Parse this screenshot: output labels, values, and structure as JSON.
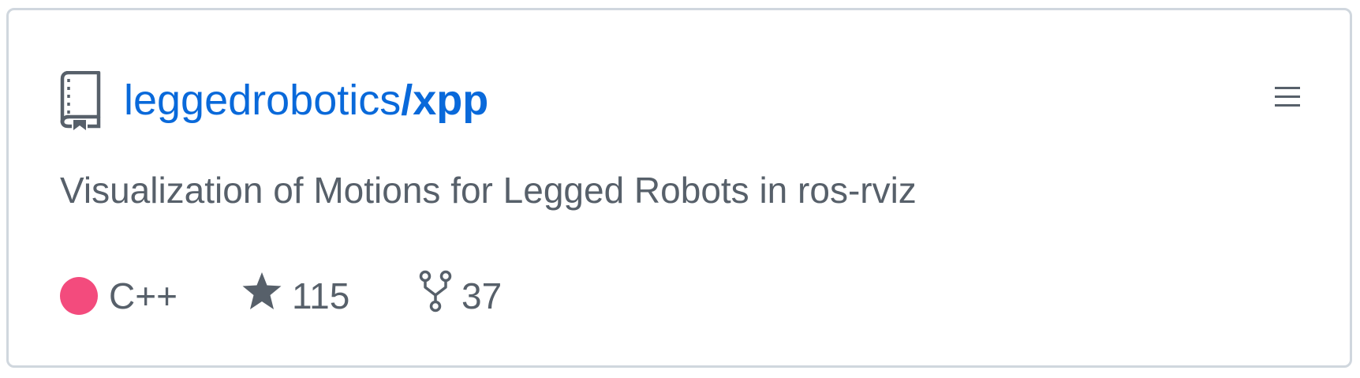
{
  "repo": {
    "owner": "leggedrobotics",
    "separator": "/",
    "name": "xpp",
    "description": "Visualization of Motions for Legged Robots in ros-rviz",
    "icon": "repo-book-icon",
    "menu_icon": "hamburger-menu-icon"
  },
  "meta": {
    "language": "C++",
    "language_color": "#f34b7d",
    "stars": "115",
    "star_icon": "star-icon",
    "forks": "37",
    "fork_icon": "fork-icon"
  },
  "colors": {
    "link": "#0969da",
    "text_muted": "#57606a",
    "border": "#d0d7de"
  }
}
